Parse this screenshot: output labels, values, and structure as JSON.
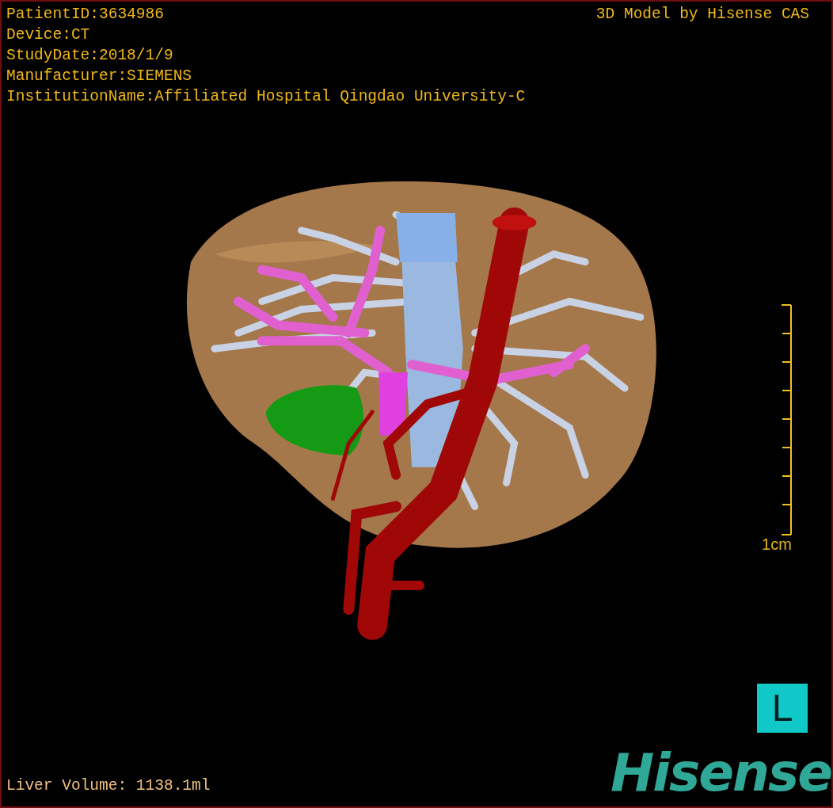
{
  "header_lines": [
    "PatientID:3634986",
    "Device:CT",
    "StudyDate:2018/1/9",
    "Manufacturer:SIEMENS",
    "InstitutionName:Affiliated Hospital Qingdao University-C"
  ],
  "credit": "3D Model by Hisense CAS",
  "scale_bar": {
    "label": "1cm"
  },
  "orientation_marker": "L",
  "logo": "Hisense",
  "liver_volume": "Liver Volume: 1138.1ml"
}
